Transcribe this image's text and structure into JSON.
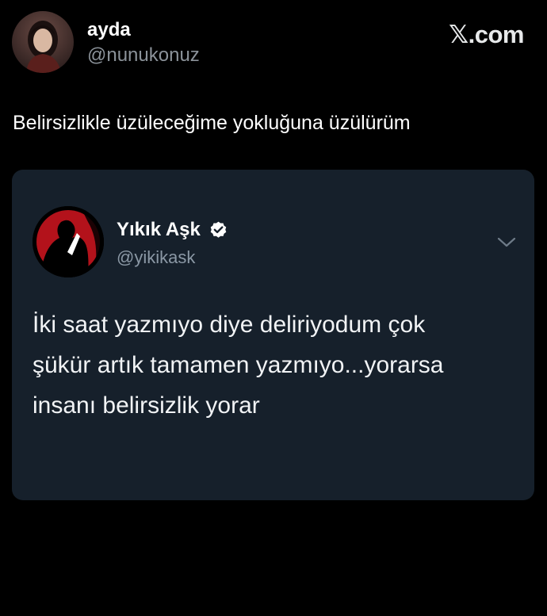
{
  "author": {
    "name": "ayda",
    "handle": "@nunukonuz",
    "avatar_icon": "profile-photo"
  },
  "brand": {
    "logo_letter": "𝕏",
    "logo_suffix": ".com"
  },
  "tweet": {
    "text": "Belirsizlikle üzüleceğime yokluğuna üzülürüm"
  },
  "quoted": {
    "name": "Yıkık Aşk",
    "handle": "@yikikask",
    "verified_icon": "verified-badge-icon",
    "menu_icon": "chevron-down-icon",
    "body_lines": [
      "İki saat yazmıyo diye deliriyodum çok",
      "şükür artık tamamen yazmıyo...yorarsa",
      "insanı belirsizlik yorar"
    ]
  },
  "colors": {
    "background": "#000000",
    "card": "#16202b",
    "handle": "#8b9299",
    "avatar_red": "#b3121b"
  }
}
